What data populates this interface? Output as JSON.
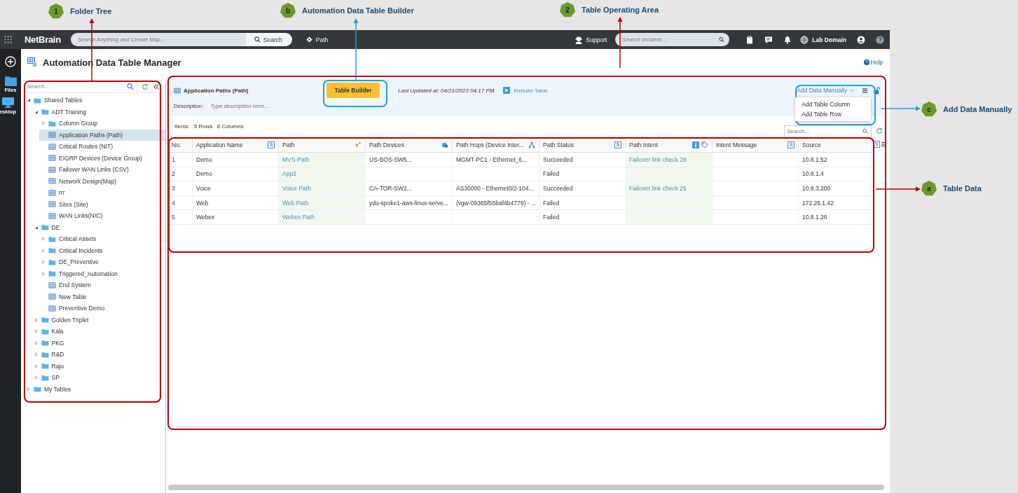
{
  "annotations": [
    {
      "badge": "1",
      "label": "Folder Tree",
      "color": "#c00000"
    },
    {
      "badge": "b",
      "label": "Automation Data Table Builder",
      "color": "#1aa3d9"
    },
    {
      "badge": "2",
      "label": "Table Operating Area",
      "color": "#c00000"
    },
    {
      "badge": "c",
      "label": "Add Data Manually",
      "color": "#1aa3d9"
    },
    {
      "badge": "a",
      "label": "Table Data",
      "color": "#c00000"
    }
  ],
  "topbar": {
    "logo": "NetBrain",
    "search": {
      "placeholder": "Search Anything and Create Map...",
      "button": "Search"
    },
    "path": "Path",
    "support": "Support",
    "incident_search": {
      "placeholder": "Search Incident..."
    },
    "domain": "Lab Domain"
  },
  "rail": {
    "items": [
      {
        "kind": "files",
        "label": "Files"
      },
      {
        "kind": "desktop",
        "label": "esktop"
      }
    ]
  },
  "page": {
    "title": "Automation Data Table Manager",
    "help": "Help"
  },
  "tree": {
    "search": {
      "placeholder": "Search..."
    },
    "items": [
      {
        "label": "Shared Tables",
        "kind": "folder",
        "expanded": true,
        "selected": false,
        "children": [
          {
            "label": "ADT Training",
            "kind": "folder",
            "expanded": true,
            "selected": false,
            "children": [
              {
                "label": "Column Group",
                "kind": "folder",
                "expanded": false,
                "selected": false
              },
              {
                "label": "Application Paths (Path)",
                "kind": "table",
                "selected": true
              },
              {
                "label": "Critical Routes (NIT)",
                "kind": "table",
                "selected": false
              },
              {
                "label": "EIGRP Devices (Device Group)",
                "kind": "table",
                "selected": false
              },
              {
                "label": "Failover WAN Links (CSV)",
                "kind": "table",
                "selected": false
              },
              {
                "label": "Network Design(Map)",
                "kind": "table",
                "selected": false
              },
              {
                "label": "rrr",
                "kind": "table",
                "selected": false
              },
              {
                "label": "Sites (Site)",
                "kind": "table",
                "selected": false
              },
              {
                "label": "WAN Links(NIC)",
                "kind": "table",
                "selected": false
              }
            ]
          },
          {
            "label": "DE",
            "kind": "folder",
            "expanded": true,
            "selected": false,
            "children": [
              {
                "label": "Critical Assets",
                "kind": "folder",
                "expanded": false,
                "selected": false
              },
              {
                "label": "Critical Incidents",
                "kind": "folder",
                "expanded": false,
                "selected": false
              },
              {
                "label": "DE_Preventive",
                "kind": "folder",
                "expanded": false,
                "selected": false
              },
              {
                "label": "Triggered_Automation",
                "kind": "folder",
                "expanded": false,
                "selected": false
              },
              {
                "label": "End System",
                "kind": "table",
                "selected": false
              },
              {
                "label": "New Table",
                "kind": "table",
                "selected": false
              },
              {
                "label": "Preventive Demo",
                "kind": "table",
                "selected": false
              }
            ]
          },
          {
            "label": "Golden Triplet",
            "kind": "folder",
            "expanded": false,
            "selected": false
          },
          {
            "label": "Kala",
            "kind": "folder",
            "expanded": false,
            "selected": false
          },
          {
            "label": "PKG",
            "kind": "folder",
            "expanded": false,
            "selected": false
          },
          {
            "label": "R&D",
            "kind": "folder",
            "expanded": false,
            "selected": false
          },
          {
            "label": "Raju",
            "kind": "folder",
            "expanded": false,
            "selected": false
          },
          {
            "label": "SP",
            "kind": "folder",
            "expanded": false,
            "selected": false
          }
        ]
      },
      {
        "label": "My Tables",
        "kind": "folder",
        "expanded": false,
        "selected": false
      }
    ]
  },
  "table_panel": {
    "title": "Application Paths (Path)",
    "builder_button": "Table Builder",
    "last_updated": "Last Updated at: 04/21/2023 04:17 PM",
    "rebuild": "Rebuild Table",
    "add_data": "Add Data Manually",
    "add_data_menu": {
      "expanded": true,
      "items": [
        "Add Table Column",
        "Add Table Row"
      ]
    },
    "description": {
      "label": "Description:",
      "placeholder": "Type description here..."
    },
    "items_label": "Items:",
    "rows_count": "5 Rows",
    "columns_count": "8 Columns",
    "search": {
      "placeholder": "Search..."
    }
  },
  "table": {
    "columns": [
      {
        "label": "No.",
        "kind": "text"
      },
      {
        "label": "Application Name",
        "kind": "text",
        "badge": "S"
      },
      {
        "label": "Path",
        "kind": "link"
      },
      {
        "label": "Path Devices",
        "kind": "text"
      },
      {
        "label": "Path Hops (Device Inter...",
        "kind": "text"
      },
      {
        "label": "Path Status",
        "kind": "text",
        "badge": "S"
      },
      {
        "label": "Path Intent",
        "kind": "link"
      },
      {
        "label": "Intent Message",
        "kind": "text",
        "badge": "S"
      },
      {
        "label": "Source",
        "kind": "text"
      }
    ],
    "settings_badge": "S",
    "rows": [
      {
        "cells": [
          "1",
          "Demo",
          "MVS-Path",
          "US-BOS-SW5...",
          "MGMT-PC1 - Ethernet_6...",
          "Succeeded",
          "Failover link check 28",
          null,
          "10.8.1.52"
        ]
      },
      {
        "cells": [
          "2",
          "Demo",
          "App3",
          null,
          null,
          "Failed",
          null,
          null,
          "10.8.1.4"
        ]
      },
      {
        "cells": [
          "3",
          "Voice",
          "Voice Path",
          "CA-TOR-SW2...",
          "AS30000 - Ethernet0/2-104...",
          "Succeeded",
          "Failover link check 25",
          null,
          "10.8.3.200"
        ]
      },
      {
        "cells": [
          "4",
          "Web",
          "Web Path",
          "ydu-spoke1-aws-linux-serve...",
          "(vgw-09365f55baf4b4779) - ...",
          "Failed",
          null,
          null,
          "172.26.1.42"
        ]
      },
      {
        "cells": [
          "5",
          "Webex",
          "Webex Path",
          null,
          null,
          "Failed",
          null,
          null,
          "10.8.1.26"
        ]
      }
    ]
  }
}
